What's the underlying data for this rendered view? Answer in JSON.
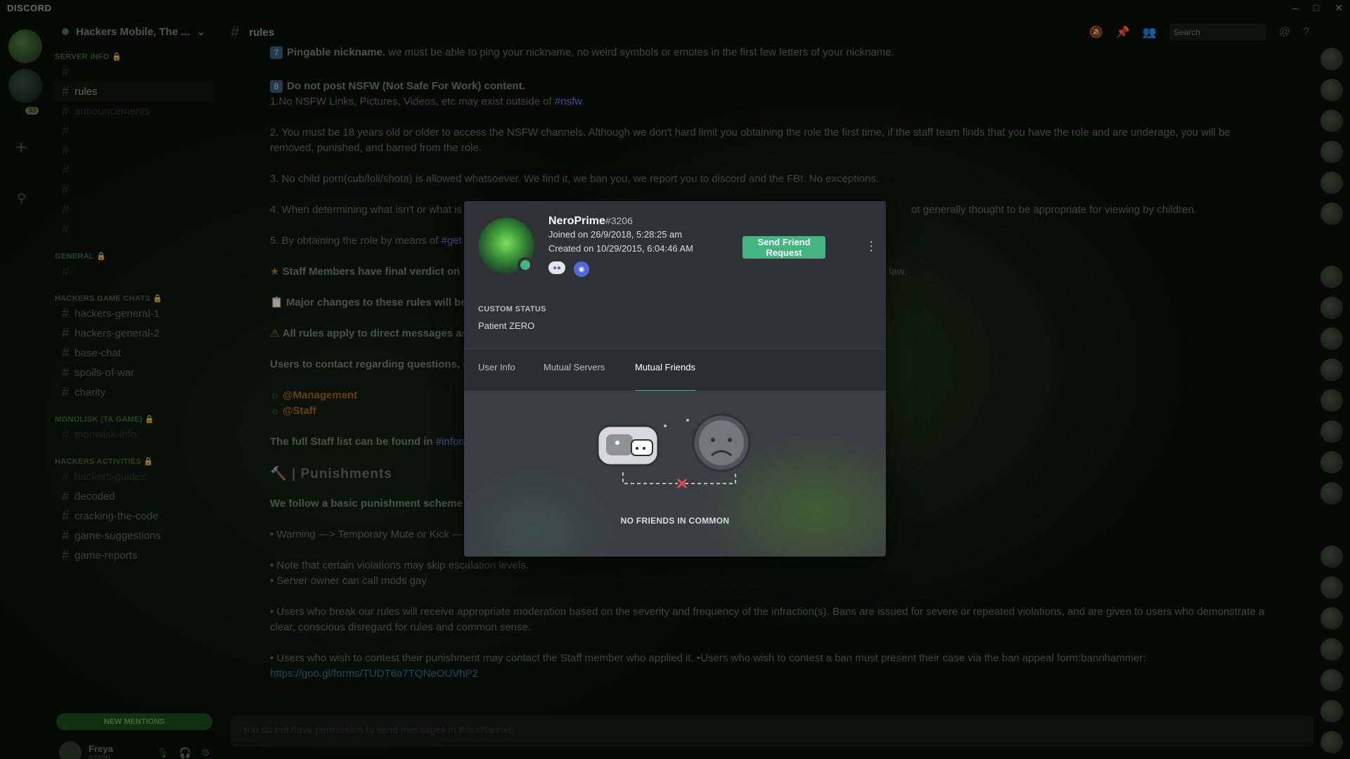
{
  "app": {
    "brand": "DISCORD"
  },
  "server": {
    "name": "Hackers Mobile, The ...",
    "badge": "33"
  },
  "channel": {
    "name": "rules"
  },
  "sidebar": {
    "categories": [
      {
        "label": "SERVER INFO 🔒"
      },
      {
        "label": "GENERAL 🔒"
      },
      {
        "label": "HACKERS GAME CHATS 🔒"
      },
      {
        "label": "MONOLISK (TA GAME) 🔒"
      },
      {
        "label": "HACKERS ACTIVITIES 🔒"
      }
    ],
    "channels": {
      "rules": "rules",
      "announcements": "announcements",
      "hg1": "hackers-general-1",
      "hg2": "hackers-general-2",
      "base": "base-chat",
      "spoils": "spoils-of-war",
      "charity": "charity",
      "monolisk": "monolisk-info",
      "guides": "hackers-guides",
      "decoded": "decoded",
      "cracking": "cracking-the-code",
      "suggestions": "game-suggestions",
      "reports": "game-reports"
    },
    "new_mentions": "NEW MENTIONS"
  },
  "user": {
    "name": "Freya",
    "tag": "#3899"
  },
  "messages": {
    "r7_title": "Pingable nickname.",
    "r7_text": "we must be able to ping your nickname, no weird symbols or emotes in the first few letters of your nickname.",
    "r8_title": "Do not post NSFW (Not Safe For Work) content.",
    "r8_1": "1.No NSFW Links, Pictures, Videos, etc may exist outside of ",
    "nsfw": "#nsfw",
    "r8_2a": "2. You must be 18 years old or older to access the NSFW channels. Although we don't hard limit you obtaining the role the first time, if the staff team finds that you have the role and are underage, you will be",
    "r8_2b": "removed, punished, and barred from the role.",
    "r8_3": "3. No child porn(cub/loli/shota) is allowed whatsoever.  We find it, we ban you, we report you to discord and the FBI.  No exceptions.",
    "r8_4": "4. When determining what isn't or what is",
    "r8_4b": "ot generally thought to be appropriate for viewing by children.",
    "r8_5": "5. By obtaining the role by means of",
    "r8_5b": "#get",
    "staff_verdict": "Staff Members have final verdict on",
    "law": "law.",
    "major_changes": "Major changes to these rules will be",
    "dm_rules": "All rules apply to direct messages as",
    "contact": "Users to contact regarding questions, re",
    "management": "@Management",
    "staff": "@Staff",
    "staff_list": "The full Staff list can be found in",
    "inform": "#inform",
    "punishments": "| Punishments",
    "scheme": "We follow a basic punishment scheme:",
    "warning": "• Warning —> Temporary Mute or Kick —",
    "skip": "• Note that certain violations may skip escalation levels.",
    "owner": "• Server owner can call mods gay",
    "moderation_a": "• Users who break our rules will receive appropriate moderation based on the severity and frequency of the infraction(s). Bans are issued for severe or repeated violations, and are given to users who demonstrate a",
    "moderation_b": "clear, conscious disregard for rules and common sense.",
    "contest": "• Users who wish to contest their punishment may contact the Staff member who applied it. •Users who wish to contest a ban must present their case via the ban appeal form:bannhammer:",
    "link": "https://goo.gl/forms/TUDT6a7TQNeOUVhP2",
    "composer": "You do not have permission to send messages in this channel."
  },
  "header": {
    "search_placeholder": "Search"
  },
  "profile": {
    "username": "NeroPrime",
    "discriminator": "#3206",
    "joined": "Joined on 26/9/2018, 5:28:25 am",
    "created": "Created on 10/29/2015, 6:04:46 AM",
    "send_friend_request": "Send Friend Request",
    "custom_status_label": "CUSTOM STATUS",
    "custom_status_value": "Patient ZERO",
    "tabs": [
      "User Info",
      "Mutual Servers",
      "Mutual Friends"
    ],
    "active_tab": "Mutual Friends",
    "empty_text": "NO FRIENDS IN COMMON",
    "status_color": "#43b581"
  }
}
